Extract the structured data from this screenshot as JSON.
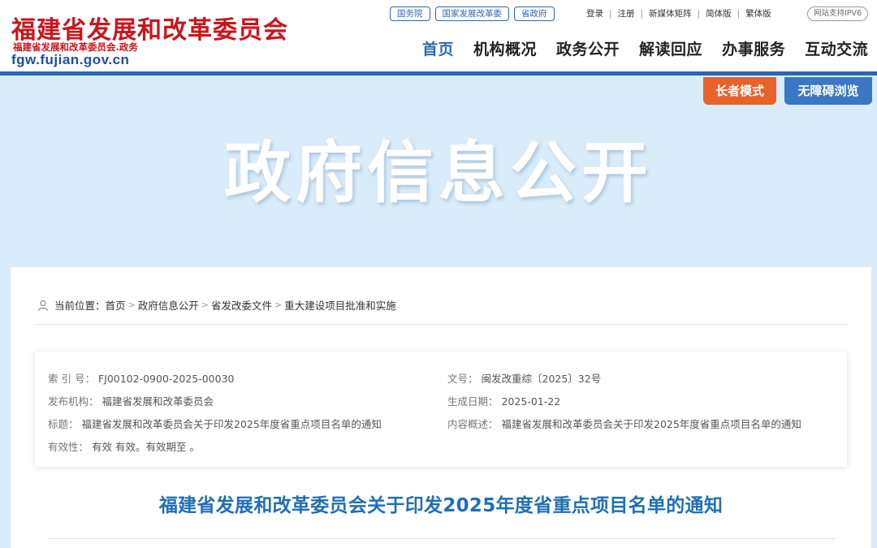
{
  "header": {
    "logo_title": "福建省发展和改革委员会",
    "logo_sub": "福建省发展和改革委员会.政务",
    "logo_domain": "fgw.fujian.gov.cn",
    "quicklinks": [
      "国务院",
      "国家发展改革委",
      "省政府"
    ],
    "toplinks": [
      "登录",
      "注册",
      "新媒体矩阵",
      "简体版",
      "繁体版"
    ],
    "ipv6": "网站支持IPV6",
    "nav": [
      "首页",
      "机构概况",
      "政务公开",
      "解读回应",
      "办事服务",
      "互动交流"
    ]
  },
  "accessibility": {
    "elder_mode": "长者模式",
    "barrier_free": "无障碍浏览"
  },
  "banner": {
    "title": "政府信息公开"
  },
  "breadcrumb": {
    "prefix": "当前位置：",
    "items": [
      "首页",
      "政府信息公开",
      "省发改委文件",
      "重大建设项目批准和实施"
    ],
    "sep": ">"
  },
  "meta": {
    "index_label": "索 引 号：",
    "index_value": "FJ00102-0900-2025-00030",
    "docno_label": "文号：",
    "docno_value": "闽发改重综〔2025〕32号",
    "publisher_label": "发布机构：",
    "publisher_value": "福建省发展和改革委员会",
    "date_label": "生成日期：",
    "date_value": "2025-01-22",
    "title_label": "标题：",
    "title_value": "福建省发展和改革委员会关于印发2025年度省重点项目名单的通知",
    "summary_label": "内容概述：",
    "summary_value": "福建省发展和改革委员会关于印发2025年度省重点项目名单的通知",
    "validity_label": "有效性：",
    "validity_value": "有效 有效。有效期至 。"
  },
  "document": {
    "title": "福建省发展和改革委员会关于印发2025年度省重点项目名单的通知"
  },
  "colors": {
    "brand_red": "#c8161d",
    "brand_blue": "#2a66b4",
    "elder_orange": "#e8622c",
    "title_blue": "#1f6fb6"
  }
}
